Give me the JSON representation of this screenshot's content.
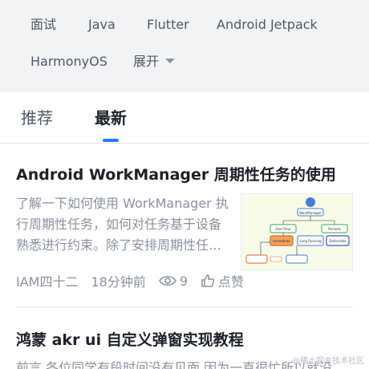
{
  "tags": {
    "row1": [
      "面试",
      "Java",
      "Flutter",
      "Android Jetpack"
    ],
    "row2": [
      "HarmonyOS"
    ],
    "expand_label": "展开"
  },
  "tabs": {
    "recommend": "推荐",
    "latest": "最新"
  },
  "articles": [
    {
      "title": "Android WorkManager 周期性任务的使用",
      "description_lines": [
        "了解一下如何使用 WorkManager 执",
        "行周期性任务，如何对任务基于设备",
        "熟悉进行约束。除了安排周期性任…"
      ],
      "author": "IAM四十二",
      "time": "18分钟前",
      "views": "9",
      "like_label": "点赞",
      "thumbnail_nodes": [
        "WorkManager",
        "One-Time",
        "Periodic",
        "Immediate",
        "Long Running",
        "Deferrable"
      ]
    },
    {
      "title": "鸿蒙 akr ui 自定义弹窗实现教程",
      "description": "前言 各位同学有段时间没有见面 因为一直很忙所以就没"
    }
  ],
  "watermark": "@稀土掘金技术社区",
  "colors": {
    "accent": "#1e80ff",
    "tag_background": "#f2f3f5",
    "secondary_text": "#8a919f"
  }
}
